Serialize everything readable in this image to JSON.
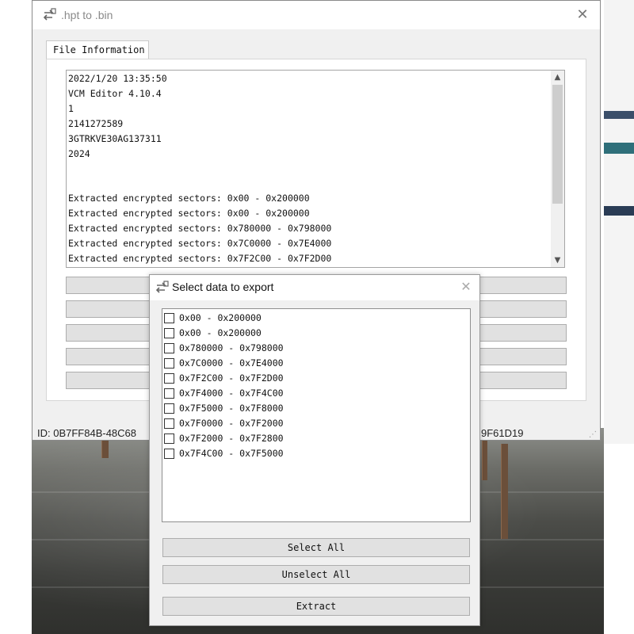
{
  "main_window": {
    "title": ".hpt to .bin",
    "tab_label": "File Information",
    "file_info_lines": [
      "2022/1/20 13:35:50",
      "VCM Editor 4.10.4",
      "1",
      "2141272589",
      "3GTRKVE30AG137311",
      "2024",
      "",
      "",
      "Extracted encrypted sectors: 0x00 - 0x200000",
      "Extracted encrypted sectors: 0x00 - 0x200000",
      "Extracted encrypted sectors: 0x780000 - 0x798000",
      "Extracted encrypted sectors: 0x7C0000 - 0x7E4000",
      "Extracted encrypted sectors: 0x7F2C00 - 0x7F2D00"
    ],
    "status_id_left": "ID:  0B7FF84B-48C68",
    "status_id_right": "9F61D19"
  },
  "dialog": {
    "title": "Select data to export",
    "items": [
      "0x00 - 0x200000",
      "0x00 - 0x200000",
      "0x780000 - 0x798000",
      "0x7C0000 - 0x7E4000",
      "0x7F2C00 - 0x7F2D00",
      "0x7F4000 - 0x7F4C00",
      "0x7F5000 - 0x7F8000",
      "0x7F0000 - 0x7F2000",
      "0x7F2000 - 0x7F2800",
      "0x7F4C00 - 0x7F5000"
    ],
    "select_all_label": "Select All",
    "unselect_all_label": "Unselect All",
    "extract_label": "Extract"
  },
  "icons": {
    "app": "convert-arrows-icon",
    "close": "close-icon",
    "scroll_up": "chevron-up-icon",
    "scroll_down": "chevron-down-icon"
  }
}
